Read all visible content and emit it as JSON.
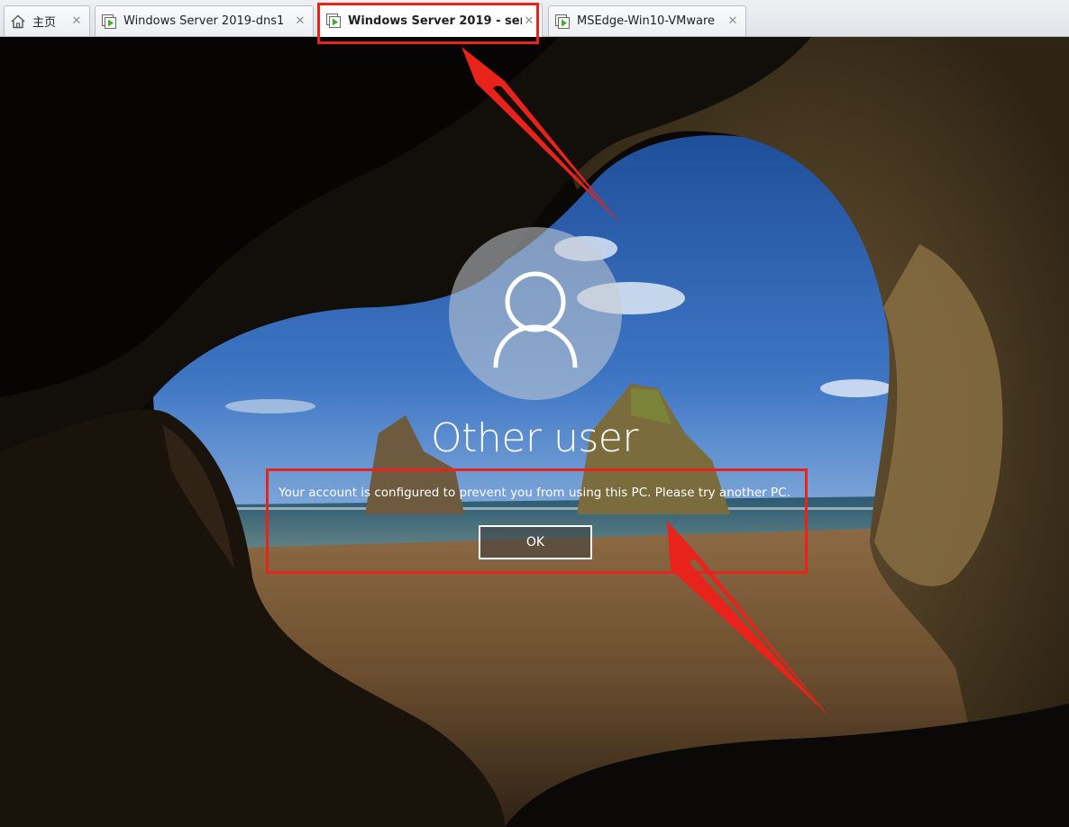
{
  "tabs": [
    {
      "label": "主页",
      "icon": "home-icon",
      "active": false
    },
    {
      "label": "Windows Server 2019-dns1",
      "icon": "vm-running-icon",
      "active": false
    },
    {
      "label": "Windows Server 2019 - ser...",
      "icon": "vm-running-icon",
      "active": true
    },
    {
      "label": "MSEdge-Win10-VMware",
      "icon": "vm-running-icon",
      "active": false
    }
  ],
  "lock_screen": {
    "user_name": "Other user",
    "message": "Your account is configured to prevent you from using this PC. Please try another PC.",
    "ok_label": "OK",
    "avatar_icon": "user-silhouette-icon"
  },
  "colors": {
    "annotation_red": "#e8231c",
    "tab_text": "#222222",
    "vm_icon_green": "#3fae29"
  }
}
